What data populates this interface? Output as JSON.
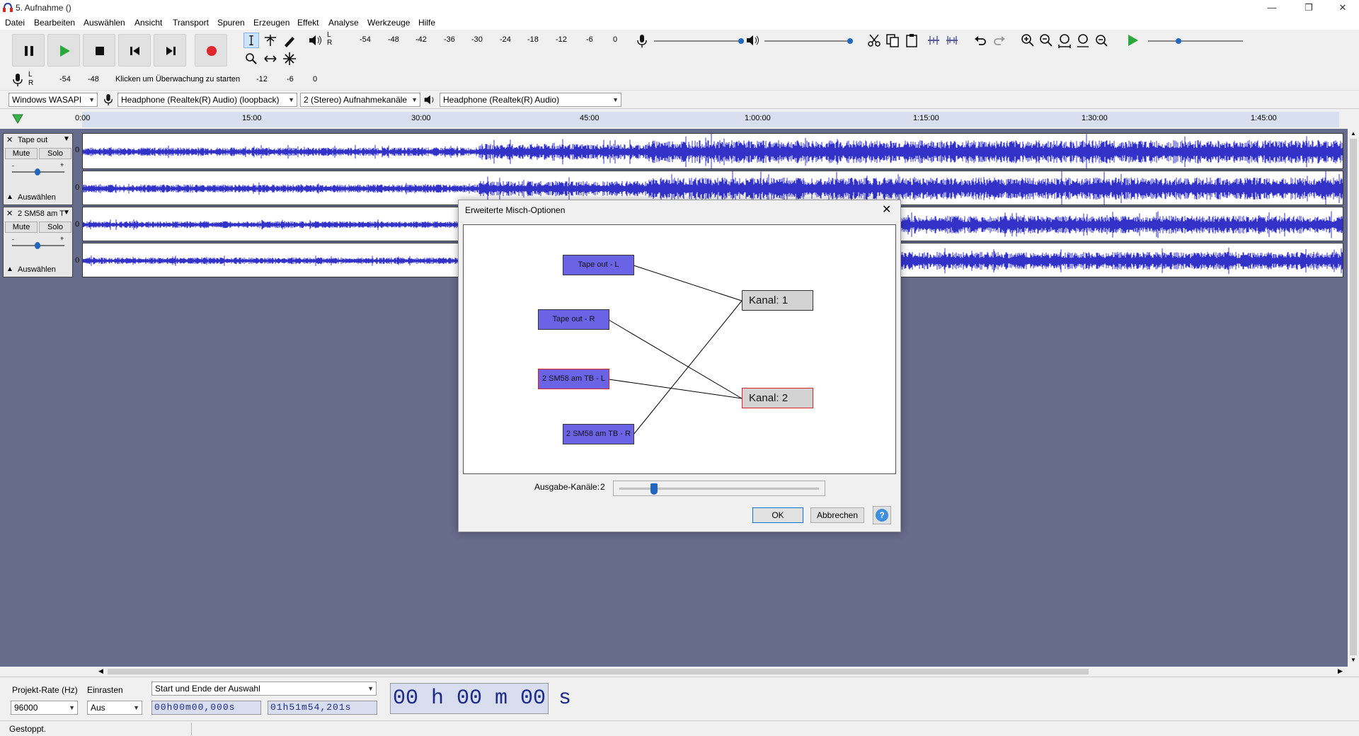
{
  "window": {
    "title": "5. Aufnahme ()",
    "minimize": "—",
    "restore": "❐",
    "close": "✕"
  },
  "menu": [
    "Datei",
    "Bearbeiten",
    "Auswählen",
    "Ansicht",
    "Transport",
    "Spuren",
    "Erzeugen",
    "Effekt",
    "Analyse",
    "Werkzeuge",
    "Hilfe"
  ],
  "meters": {
    "playback_ticks": [
      "-54",
      "-48",
      "-42",
      "-36",
      "-30",
      "-24",
      "-18",
      "-12",
      "-6",
      "0"
    ],
    "record_ticks": [
      "-54",
      "-48",
      "-12",
      "-6",
      "0"
    ],
    "record_hint": "Klicken um Überwachung zu starten",
    "lr_l": "L",
    "lr_r": "R"
  },
  "devices": {
    "host": "Windows WASAPI",
    "record_device": "Headphone (Realtek(R) Audio) (loopback)",
    "channels": "2 (Stereo) Aufnahmekanäle",
    "playback_device": "Headphone (Realtek(R) Audio)"
  },
  "timeline": [
    "0:00",
    "15:00",
    "30:00",
    "45:00",
    "1:00:00",
    "1:15:00",
    "1:30:00",
    "1:45:00"
  ],
  "tracks": [
    {
      "name": "Tape out",
      "mute": "Mute",
      "solo": "Solo",
      "select": "Auswählen",
      "zero": "0"
    },
    {
      "name": "2 SM58 am T",
      "mute": "Mute",
      "solo": "Solo",
      "select": "Auswählen",
      "zero": "0"
    }
  ],
  "gain_minus": "-",
  "gain_plus": "+",
  "dialog": {
    "title": "Erweiterte Misch-Optionen",
    "sources": [
      "Tape out - L",
      "Tape out - R",
      "2 SM58 am TB - L",
      "2 SM58 am TB - R"
    ],
    "outputs": [
      "Kanal:  1",
      "Kanal:  2"
    ],
    "output_channels_label": "Ausgabe-Kanäle:",
    "output_channels_value": "2",
    "output_channels_fraction": 0.16,
    "ok": "OK",
    "cancel": "Abbrechen",
    "help": "?"
  },
  "footer": {
    "rate_label": "Projekt-Rate (Hz)",
    "rate_value": "96000",
    "snap_label": "Einrasten",
    "snap_value": "Aus",
    "selection_mode": "Start und Ende der Auswahl",
    "sel_start": "00h00m00,000s",
    "sel_end": "01h51m54,201s",
    "big_time": "00 h 00 m 00 s"
  },
  "status": "Gestoppt."
}
